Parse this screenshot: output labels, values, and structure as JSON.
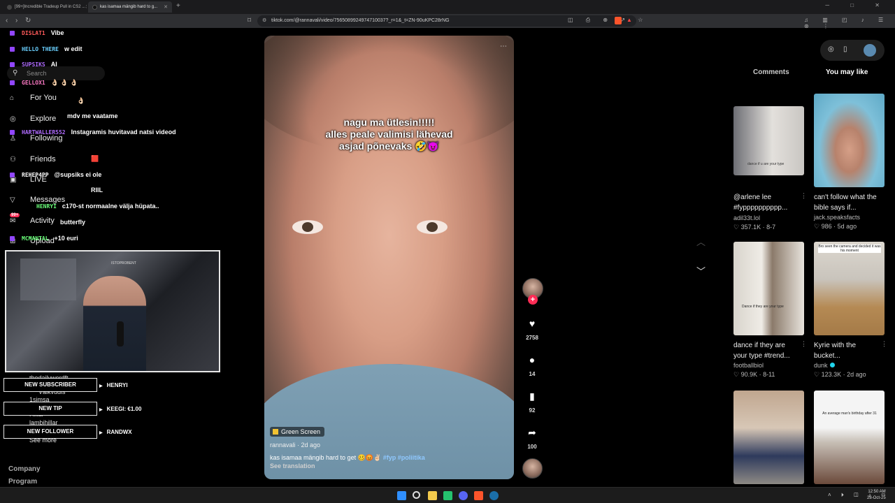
{
  "browser": {
    "tabs": [
      {
        "label": "[99+]Incredible Tradeup Pull in CS2 ..."
      },
      {
        "label": "kas isamaa mängib hard to g..."
      }
    ],
    "url": "tiktok.com/@rannavali/video/7565089924974710037?_r=1&_t=ZN-90uKPC28rNG"
  },
  "sidenav": {
    "search_placeholder": "Search",
    "items": [
      {
        "label": "For You",
        "icon": "home-icon"
      },
      {
        "label": "Explore",
        "icon": "compass-icon"
      },
      {
        "label": "Following",
        "icon": "following-icon"
      },
      {
        "label": "Friends",
        "icon": "friends-icon"
      },
      {
        "label": "LIVE",
        "icon": "live-icon"
      },
      {
        "label": "Messages",
        "icon": "messages-icon"
      },
      {
        "label": "Activity",
        "icon": "activity-icon"
      },
      {
        "label": "Upload",
        "icon": "upload-icon"
      }
    ],
    "activity_badge": "99+",
    "footer": [
      "Company",
      "Program"
    ]
  },
  "chat": [
    {
      "user": "DISLAT1",
      "msg": "Vibe",
      "color": "#ff5a5a"
    },
    {
      "user": "HELLO THERE",
      "msg": "w edit",
      "color": "#6ad0ff"
    },
    {
      "user": "SUPSIKS",
      "msg": "AI",
      "color": "#b06cff"
    },
    {
      "user": "GELLOX1",
      "msg": "👌🏻 👌🏻 👌🏻",
      "color": "#ff7ac6"
    },
    {
      "user": "",
      "msg": "👌🏻",
      "color": "#ff7ac6"
    },
    {
      "user": "",
      "msg": "mdv me vaatame",
      "color": "#ff5a5a"
    },
    {
      "user": "HARTWALLER552",
      "msg": "Instagramis huvitavad natsi videod",
      "color": "#b06cff"
    },
    {
      "user": "",
      "msg": "",
      "color": "#6ad0ff"
    },
    {
      "user": "",
      "msg": "🟥",
      "color": "#b06cff"
    },
    {
      "user": "REHEP4PP",
      "msg": "@supsiks ei ole",
      "color": "#ffffff"
    },
    {
      "user": "",
      "msg": "RIIL",
      "color": "#6ad0ff"
    },
    {
      "user": "HENRYI",
      "msg": "c170-st normaalne välja hüpata..",
      "color": "#6aff7a"
    },
    {
      "user": "",
      "msg": "butterfly",
      "color": "#ffffff"
    },
    {
      "user": "MCMANTAL",
      "msg": "+10 euri",
      "color": "#6aff7a"
    }
  ],
  "webcam": {
    "overlay_tag": "ISTOPROBENT"
  },
  "alerts": [
    {
      "label": "NEW SUBSCRIBER",
      "value": "HENRYI",
      "color": "#2aa8ff"
    },
    {
      "label": "NEW TIP",
      "value": "KEEGI: €1.00",
      "color": "#2aa8ff"
    },
    {
      "label": "NEW FOLLOWER",
      "value": "RANDWX",
      "color": "#2aa8ff"
    }
  ],
  "underlay_names": [
    "thedailywordft",
    "Välkvudis",
    "1simsa",
    "Hillar",
    "lambihillar",
    "See more"
  ],
  "video": {
    "overlay_lines": [
      "nagu ma ütlesin!!!!!",
      "alles peale valimisi lähevad",
      "asjad põnevaks 🤣😈"
    ],
    "effect": "Green Screen",
    "author": "rannavali · 2d ago",
    "caption": "kas isamaa mängib hard to get 🥴😡✌🏻",
    "hashtags": [
      "#fyp",
      "#poliitika"
    ],
    "see_translation": "See translation"
  },
  "actions": {
    "likes": "2758",
    "comments": "14",
    "saves": "92",
    "shares": "100"
  },
  "right_panel": {
    "tabs": [
      "Comments",
      "You may like"
    ],
    "cards": [
      {
        "title": "@arlene lee #fypppppppppp...",
        "user": "adil33t.lol",
        "stats": "♡ 357.1K · 8-7",
        "thumb_text": "dance if u are your type",
        "colors": [
          "#6d6e74",
          "#e3e0dc"
        ]
      },
      {
        "title": "can't follow what the bible says if...",
        "user": "jack.speaksfacts",
        "stats": "♡ 986 · 5d ago",
        "thumb_text": "",
        "colors": [
          "#7ec0d9",
          "#d59f87"
        ]
      },
      {
        "title": "dance if they are your type #trend...",
        "user": "footballbiol",
        "stats": "♡ 90.9K · 8-11",
        "thumb_text": "Dance if they are your type",
        "colors": [
          "#d8d4cc",
          "#8b7a6a"
        ]
      },
      {
        "title": "Kyrie with the bucket...",
        "user": "dunk",
        "stats": "♡ 123.3K · 2d ago",
        "thumb_text": "Bro seen the camera and decided it was his moment",
        "colors": [
          "#b58a54",
          "#dcd7cf"
        ]
      },
      {
        "title": "",
        "user": "",
        "stats": "",
        "thumb_text": "",
        "colors": [
          "#c0a68f",
          "#2e3a5c"
        ]
      },
      {
        "title": "",
        "user": "",
        "stats": "",
        "thumb_text": "An average man's birthday after 31",
        "colors": [
          "#f4f4f4",
          "#6b4a3b"
        ]
      }
    ]
  },
  "taskbar": {
    "time": "12:50 AM",
    "date": "28-Oct-25"
  },
  "colors": {
    "tiktok_red": "#fe2c55",
    "hashtag": "#8fc8ff"
  }
}
